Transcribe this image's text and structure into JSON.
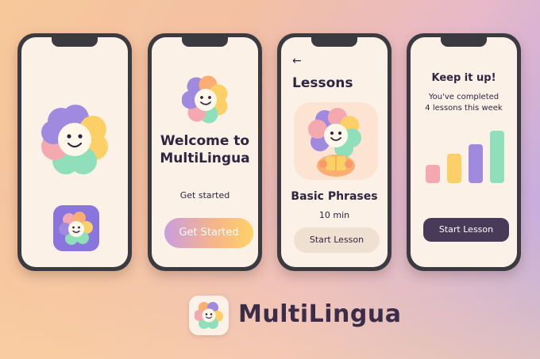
{
  "brand": {
    "name": "MultiLingua"
  },
  "welcome": {
    "title_line1": "Welcome to",
    "title_line2": "MultiLingua",
    "subtitle": "Get started",
    "button_label": "Get Started"
  },
  "lessons": {
    "back_glyph": "←",
    "title": "Lessons",
    "lesson_name": "Basic Phrases",
    "duration": "10 min",
    "button_label": "Start Lesson"
  },
  "progress": {
    "heading": "Keep it up!",
    "line1": "You've completed",
    "line2": "4 lessons this week",
    "button_label": "Start Lesson",
    "bars": [
      {
        "value": 0.32,
        "color": "#f4a9b0"
      },
      {
        "value": 0.52,
        "color": "#fdd067"
      },
      {
        "value": 0.68,
        "color": "#a08ae0"
      },
      {
        "value": 0.92,
        "color": "#8fe0ba"
      }
    ]
  },
  "colors": {
    "accent_dark": "#4a3a5a",
    "petal_purple": "#a08ae0",
    "petal_yellow": "#fdd067",
    "petal_orange": "#fbae72",
    "petal_green": "#8fe0ba",
    "petal_pink": "#f4a9b0",
    "app_icon_bg": "#8a74de"
  },
  "icons": [
    "flower-mascot-icon",
    "app-icon",
    "back-arrow-icon"
  ]
}
